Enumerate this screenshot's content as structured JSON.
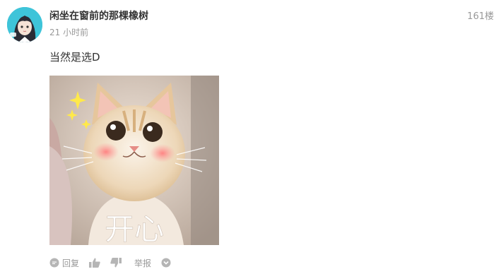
{
  "post": {
    "username": "闲坐在窗前的那棵橡树",
    "time": "21 小时前",
    "floor": "161楼",
    "comment": "当然是选D",
    "sticker_caption": "开心"
  },
  "actions": {
    "reply_label": "回复",
    "report_label": "举报"
  },
  "icons": {
    "reply": "comment-bubble-icon",
    "like": "thumbs-up-icon",
    "dislike": "thumbs-down-icon",
    "more": "chevron-down-circle-icon"
  },
  "colors": {
    "avatar_bg": "#3ec4d9",
    "muted_text": "#999999",
    "body_text": "#333333"
  }
}
